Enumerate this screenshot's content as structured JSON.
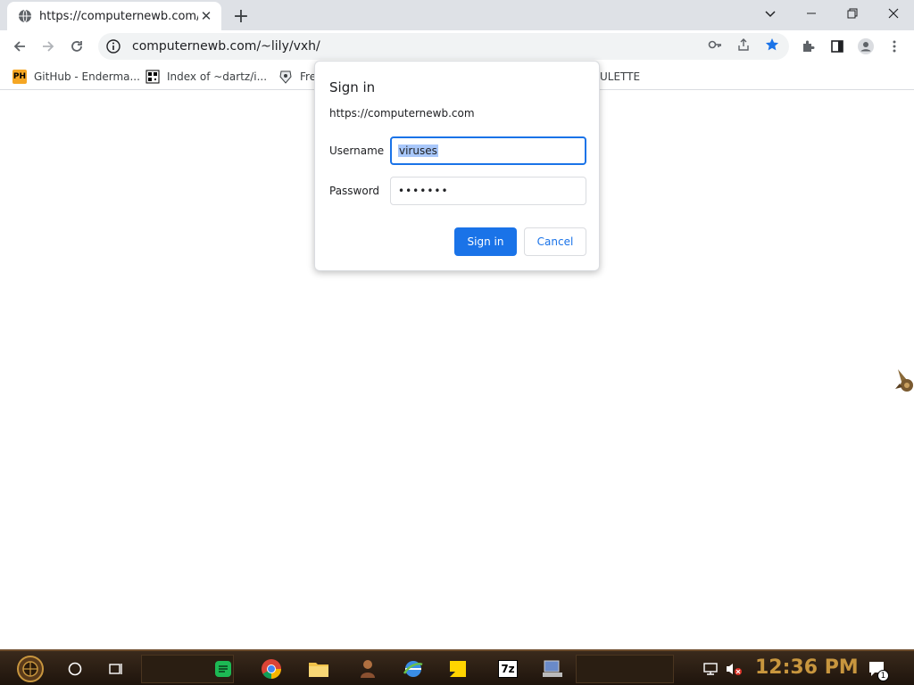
{
  "browser": {
    "tab": {
      "title": "https://computernewb.com/~li",
      "favicon": "globe-icon",
      "close_glyph": "✕"
    },
    "new_tab_glyph": "+",
    "window_controls": {
      "dropdown": "⌄",
      "minimize": "—",
      "restore": "❐",
      "close": "✕"
    },
    "toolbar": {
      "url": "computernewb.com/~lily/vxh/",
      "icons": [
        "back-icon",
        "forward-icon",
        "reload-icon",
        "info-icon",
        "key-icon",
        "share-icon",
        "star-icon",
        "extensions-icon",
        "sidepanel-icon",
        "profile-icon",
        "menu-icon"
      ]
    },
    "bookmarks": [
      {
        "label": "GitHub - Enderma...",
        "icon": "ph-icon",
        "icon_text": "PH"
      },
      {
        "label": "Index of ~dartz/i...",
        "icon": "qr-icon"
      },
      {
        "label": "Fre",
        "icon": "app-icon"
      },
      {
        "label": "ULETTE",
        "icon": ""
      }
    ]
  },
  "dialog": {
    "title": "Sign in",
    "origin": "https://computernewb.com",
    "username_label": "Username",
    "username_value": "viruses",
    "password_label": "Password",
    "password_value": "•••••••",
    "signin_label": "Sign in",
    "cancel_label": "Cancel"
  },
  "taskbar": {
    "apps": [
      "start-button-icon",
      "search-circle-icon",
      "task-view-icon",
      "notes-app-icon",
      "chrome-icon",
      "file-explorer-icon",
      "app-figure-icon",
      "ie-globe-icon",
      "sticky-notes-icon",
      "7zip-icon",
      "computer-icon"
    ],
    "sevenzip_text": "7z",
    "clock": "12:36 PM",
    "notification_count": "1"
  },
  "colors": {
    "accent": "#1a73e8",
    "taskbar_clock": "#c8963e"
  }
}
